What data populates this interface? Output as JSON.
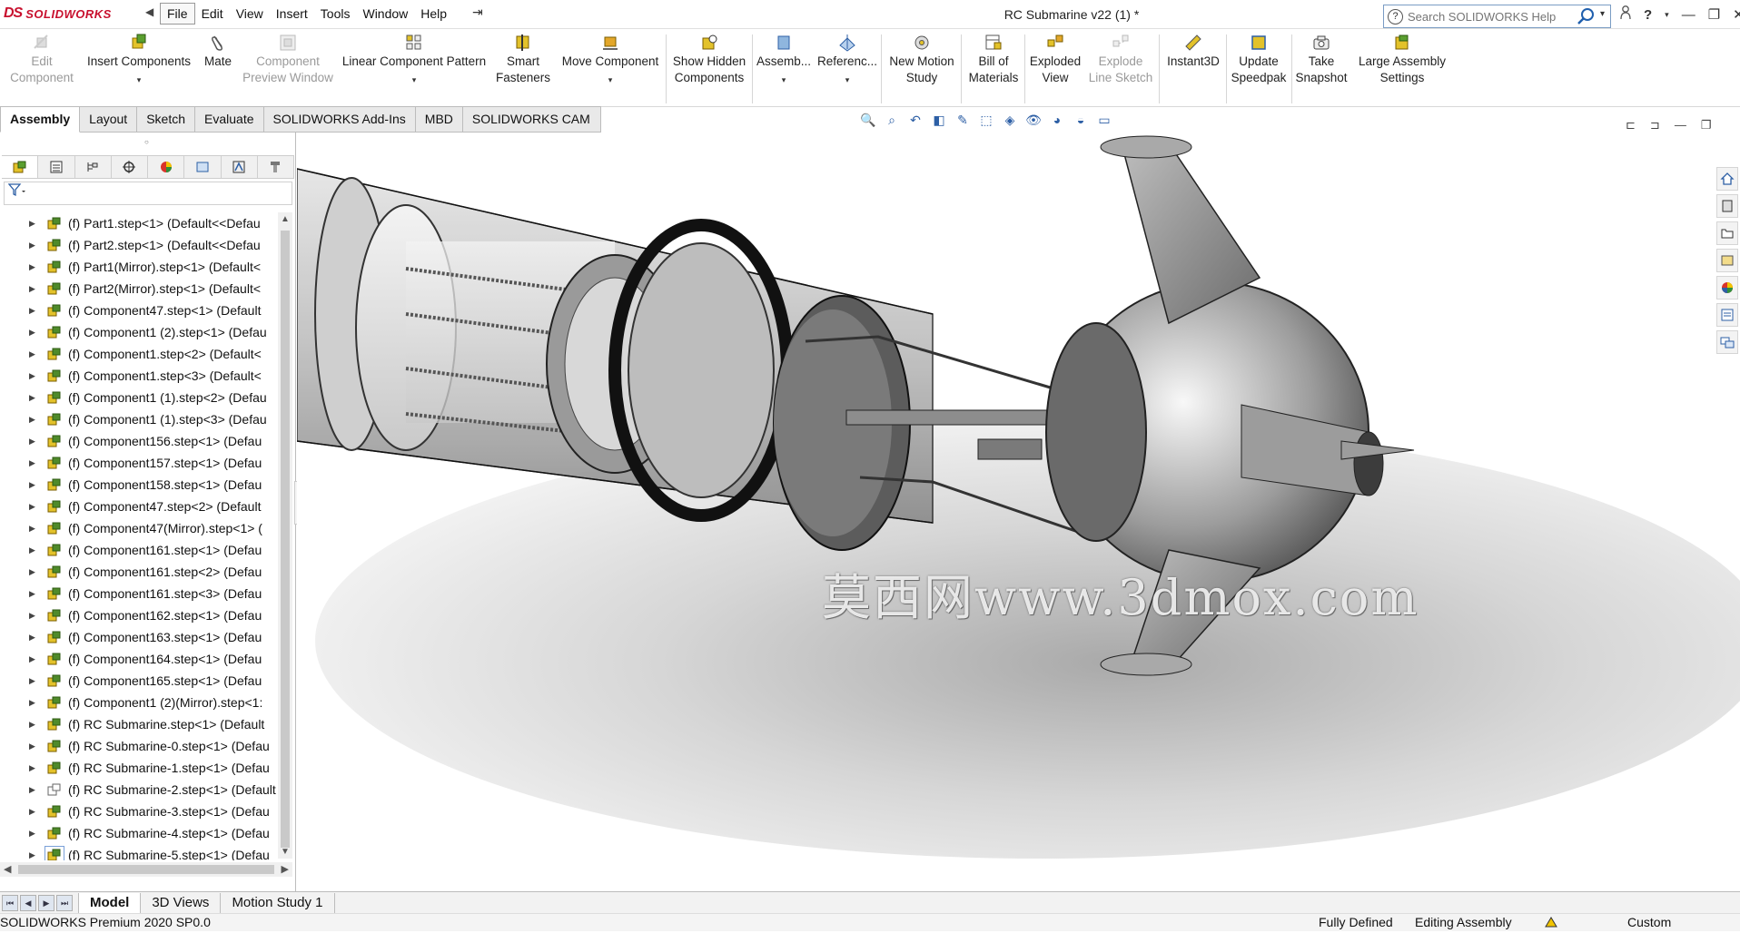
{
  "app": {
    "logo_text_prefix": "DS",
    "logo_text": "SOLIDWORKS",
    "document_title": "RC Submarine v22 (1) *"
  },
  "menu": [
    "File",
    "Edit",
    "View",
    "Insert",
    "Tools",
    "Window",
    "Help"
  ],
  "search": {
    "placeholder": "Search SOLIDWORKS Help"
  },
  "commands": [
    {
      "label": "Edit\nComponent",
      "enabled": false,
      "icon": "edit-component-icon"
    },
    {
      "label": "Insert Components",
      "enabled": true,
      "icon": "insert-components-icon"
    },
    {
      "label": "Mate",
      "enabled": true,
      "icon": "mate-icon"
    },
    {
      "label": "Component\nPreview Window",
      "enabled": false,
      "icon": "preview-window-icon"
    },
    {
      "label": "Linear Component Pattern",
      "enabled": true,
      "icon": "pattern-icon"
    },
    {
      "label": "Smart\nFasteners",
      "enabled": true,
      "icon": "fastener-icon"
    },
    {
      "label": "Move Component",
      "enabled": true,
      "icon": "move-component-icon"
    },
    {
      "label": "Show Hidden\nComponents",
      "enabled": true,
      "icon": "show-hidden-icon"
    },
    {
      "label": "Assemb...",
      "enabled": true,
      "icon": "assembly-features-icon"
    },
    {
      "label": "Referenc...",
      "enabled": true,
      "icon": "reference-geometry-icon"
    },
    {
      "label": "New Motion\nStudy",
      "enabled": true,
      "icon": "motion-study-icon"
    },
    {
      "label": "Bill of\nMaterials",
      "enabled": true,
      "icon": "bom-icon"
    },
    {
      "label": "Exploded\nView",
      "enabled": true,
      "icon": "exploded-view-icon"
    },
    {
      "label": "Explode\nLine Sketch",
      "enabled": false,
      "icon": "explode-line-icon"
    },
    {
      "label": "Instant3D",
      "enabled": true,
      "icon": "instant3d-icon"
    },
    {
      "label": "Update\nSpeedpak",
      "enabled": true,
      "icon": "speedpak-icon"
    },
    {
      "label": "Take\nSnapshot",
      "enabled": true,
      "icon": "camera-icon"
    },
    {
      "label": "Large Assembly\nSettings",
      "enabled": true,
      "icon": "large-assembly-icon"
    }
  ],
  "command_tabs": [
    "Assembly",
    "Layout",
    "Sketch",
    "Evaluate",
    "SOLIDWORKS Add-Ins",
    "MBD",
    "SOLIDWORKS CAM"
  ],
  "active_command_tab": "Assembly",
  "tree_items": [
    "(f) Part1.step<1> (Default<<Defau",
    "(f) Part2.step<1> (Default<<Defau",
    "(f) Part1(Mirror).step<1> (Default<",
    "(f) Part2(Mirror).step<1> (Default<",
    "(f) Component47.step<1> (Default",
    "(f) Component1 (2).step<1> (Defau",
    "(f) Component1.step<2> (Default<",
    "(f) Component1.step<3> (Default<",
    "(f) Component1 (1).step<2> (Defau",
    "(f) Component1 (1).step<3> (Defau",
    "(f) Component156.step<1> (Defau",
    "(f) Component157.step<1> (Defau",
    "(f) Component158.step<1> (Defau",
    "(f) Component47.step<2> (Default",
    "(f) Component47(Mirror).step<1> (",
    "(f) Component161.step<1> (Defau",
    "(f) Component161.step<2> (Defau",
    "(f) Component161.step<3> (Defau",
    "(f) Component162.step<1> (Defau",
    "(f) Component163.step<1> (Defau",
    "(f) Component164.step<1> (Defau",
    "(f) Component165.step<1> (Defau",
    "(f) Component1 (2)(Mirror).step<1:",
    "(f) RC Submarine.step<1> (Default",
    "(f) RC Submarine-0.step<1> (Defau",
    "(f) RC Submarine-1.step<1> (Defau",
    "(f) RC Submarine-2.step<1> (Default",
    "(f) RC Submarine-3.step<1> (Defau",
    "(f) RC Submarine-4.step<1> (Defau",
    "(f) RC Submarine-5.step<1> (Defau"
  ],
  "bottom_tabs": [
    "Model",
    "3D Views",
    "Motion Study 1"
  ],
  "active_bottom_tab": "Model",
  "status": {
    "product": "SOLIDWORKS Premium 2020 SP0.0",
    "definition": "Fully Defined",
    "mode": "Editing Assembly",
    "units": "Custom"
  },
  "watermark": "莫西网www.3dmox.com",
  "colors": {
    "brand_red": "#c8102e",
    "accent_blue": "#1f5fae",
    "component_yellow": "#e3c22a",
    "component_green": "#4f8a2b"
  }
}
